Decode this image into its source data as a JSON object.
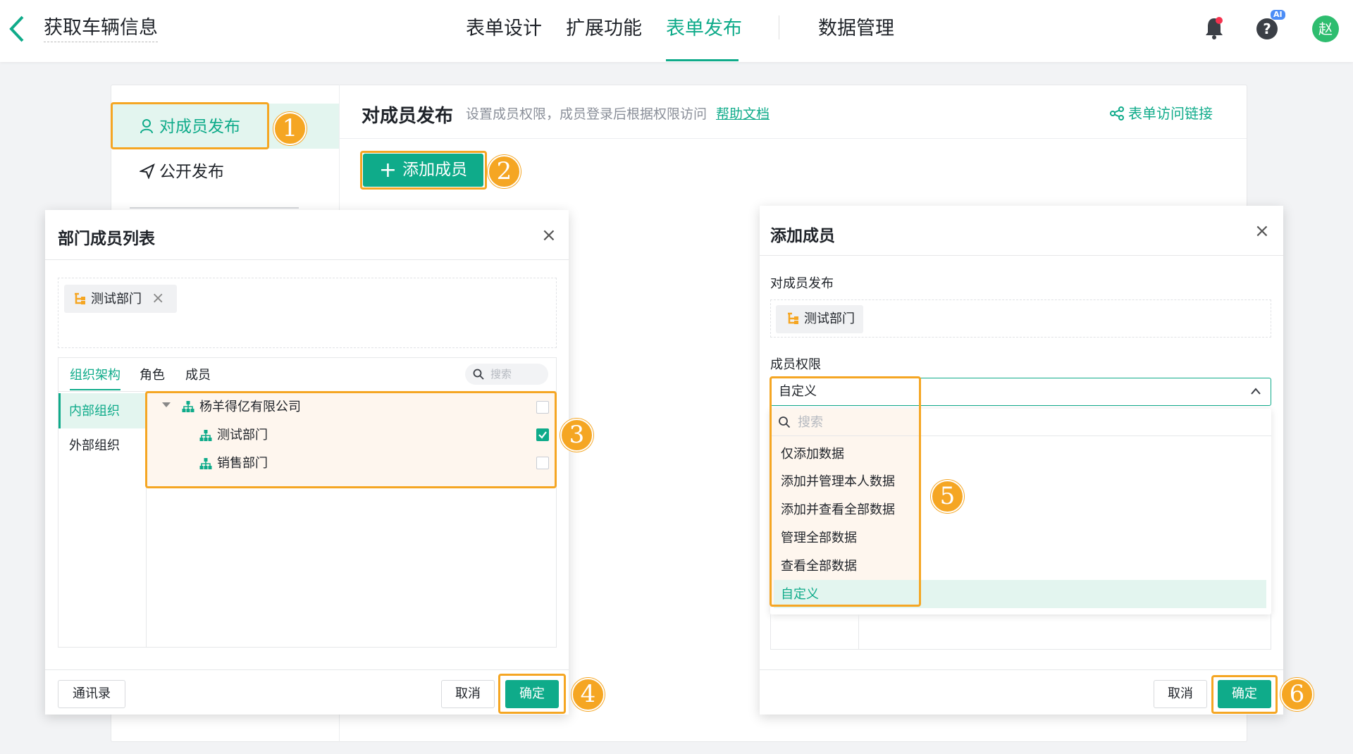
{
  "topbar": {
    "title": "获取车辆信息",
    "nav": [
      "表单设计",
      "扩展功能",
      "表单发布",
      "数据管理"
    ],
    "active_nav": "表单发布",
    "ai_badge": "AI",
    "help_glyph": "?",
    "avatar": "赵"
  },
  "sidebar": {
    "items": [
      {
        "label": "对成员发布",
        "icon": "user-icon",
        "active": true
      },
      {
        "label": "公开发布",
        "icon": "send-icon",
        "active": false
      }
    ]
  },
  "header": {
    "title": "对成员发布",
    "description": "设置成员权限，成员登录后根据权限访问",
    "help_link": "帮助文档",
    "access_link": "表单访问链接",
    "add_button": "添加成员"
  },
  "dept_modal": {
    "title": "部门成员列表",
    "selected_tag": "测试部门",
    "tabs": [
      "组织架构",
      "角色",
      "成员"
    ],
    "active_tab": "组织架构",
    "search_placeholder": "搜索",
    "org_types": [
      "内部组织",
      "外部组织"
    ],
    "tree": [
      {
        "label": "杨羊得亿有限公司",
        "level": 0,
        "checked": false
      },
      {
        "label": "测试部门",
        "level": 1,
        "checked": true
      },
      {
        "label": "销售部门",
        "level": 1,
        "checked": false
      }
    ],
    "contacts_button": "通讯录",
    "cancel": "取消",
    "confirm": "确定"
  },
  "add_modal": {
    "title": "添加成员",
    "publish_label": "对成员发布",
    "selected_tag": "测试部门",
    "permission_label": "成员权限",
    "permission_value": "自定义",
    "search_placeholder": "搜索",
    "options": [
      "仅添加数据",
      "添加并管理本人数据",
      "添加并查看全部数据",
      "管理全部数据",
      "查看全部数据",
      "自定义"
    ],
    "selected_option": "自定义",
    "cancel": "取消",
    "confirm": "确定"
  },
  "steps": [
    "1",
    "2",
    "3",
    "4",
    "5",
    "6"
  ],
  "colors": {
    "accent": "#0fab8a",
    "highlight": "#f5a623"
  }
}
